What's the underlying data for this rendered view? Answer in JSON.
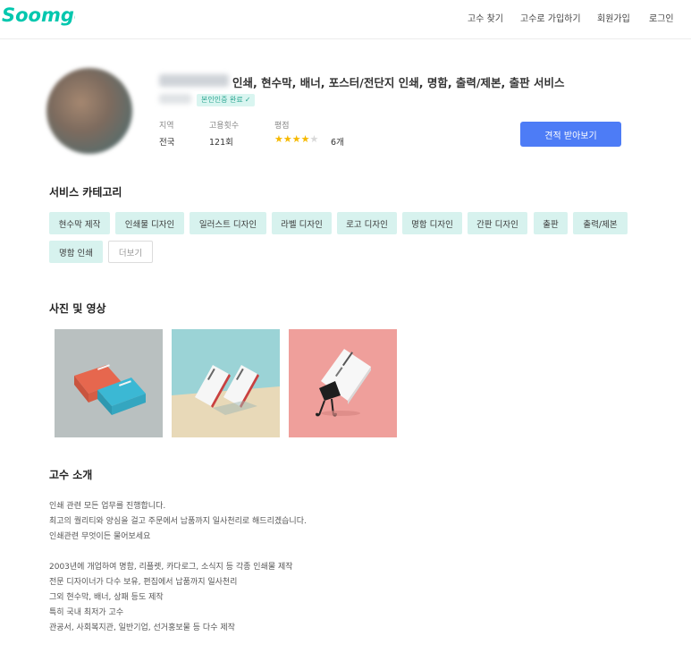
{
  "header": {
    "logo_text": "Soomgo",
    "nav": [
      "고수 찾기",
      "고수로 가입하기",
      "회원가입",
      "로그인"
    ]
  },
  "profile": {
    "headline": "인쇄, 현수막, 배너, 포스터/전단지 인쇄, 명함, 출력/제본, 출판 서비스",
    "verified_badge": "본인인증 완료",
    "stats": {
      "region_label": "지역",
      "region_value": "전국",
      "hires_label": "고용횟수",
      "hires_value": "121회",
      "rating_label": "평점",
      "rating_stars": 4,
      "rating_max": 5,
      "review_count": "6개"
    },
    "cta_label": "견적 받아보기"
  },
  "services": {
    "title": "서비스 카테고리",
    "items": [
      "현수막 제작",
      "인쇄물 디자인",
      "일러스트 디자인",
      "라벨 디자인",
      "로고 디자인",
      "명함 디자인",
      "간판 디자인",
      "출판",
      "출력/제본",
      "명함 인쇄"
    ],
    "more_label": "더보기"
  },
  "media": {
    "title": "사진 및 영상",
    "photos": [
      "business-card-stack-photo",
      "standing-cards-photo",
      "binder-clip-card-photo"
    ]
  },
  "intro": {
    "title": "고수 소개",
    "lines": [
      "인쇄 관련 모든 업무를 진행합니다.",
      "최고의 퀄리티와 양심을 걸고 주문에서 납품까지 일사천리로 해드리겠습니다.",
      "인쇄관련 무엇이든 물어보세요",
      "",
      "2003년에 개업하여 명함, 리플렛, 카다로그, 소식지 등 각종 인쇄물 제작",
      "전문 디자이너가 다수 보유, 편집에서 납품까지 일사천리",
      "그외 현수막, 배너, 상패 등도 제작",
      "특히 국내 최저가 고수",
      "관공서, 사회복지관, 일반기업, 선거홍보물 등 다수 제작"
    ]
  },
  "colors": {
    "brand": "#00c7ae",
    "cta": "#4d7cf6",
    "chip_bg": "#d7f2ee",
    "star": "#f6b900"
  }
}
